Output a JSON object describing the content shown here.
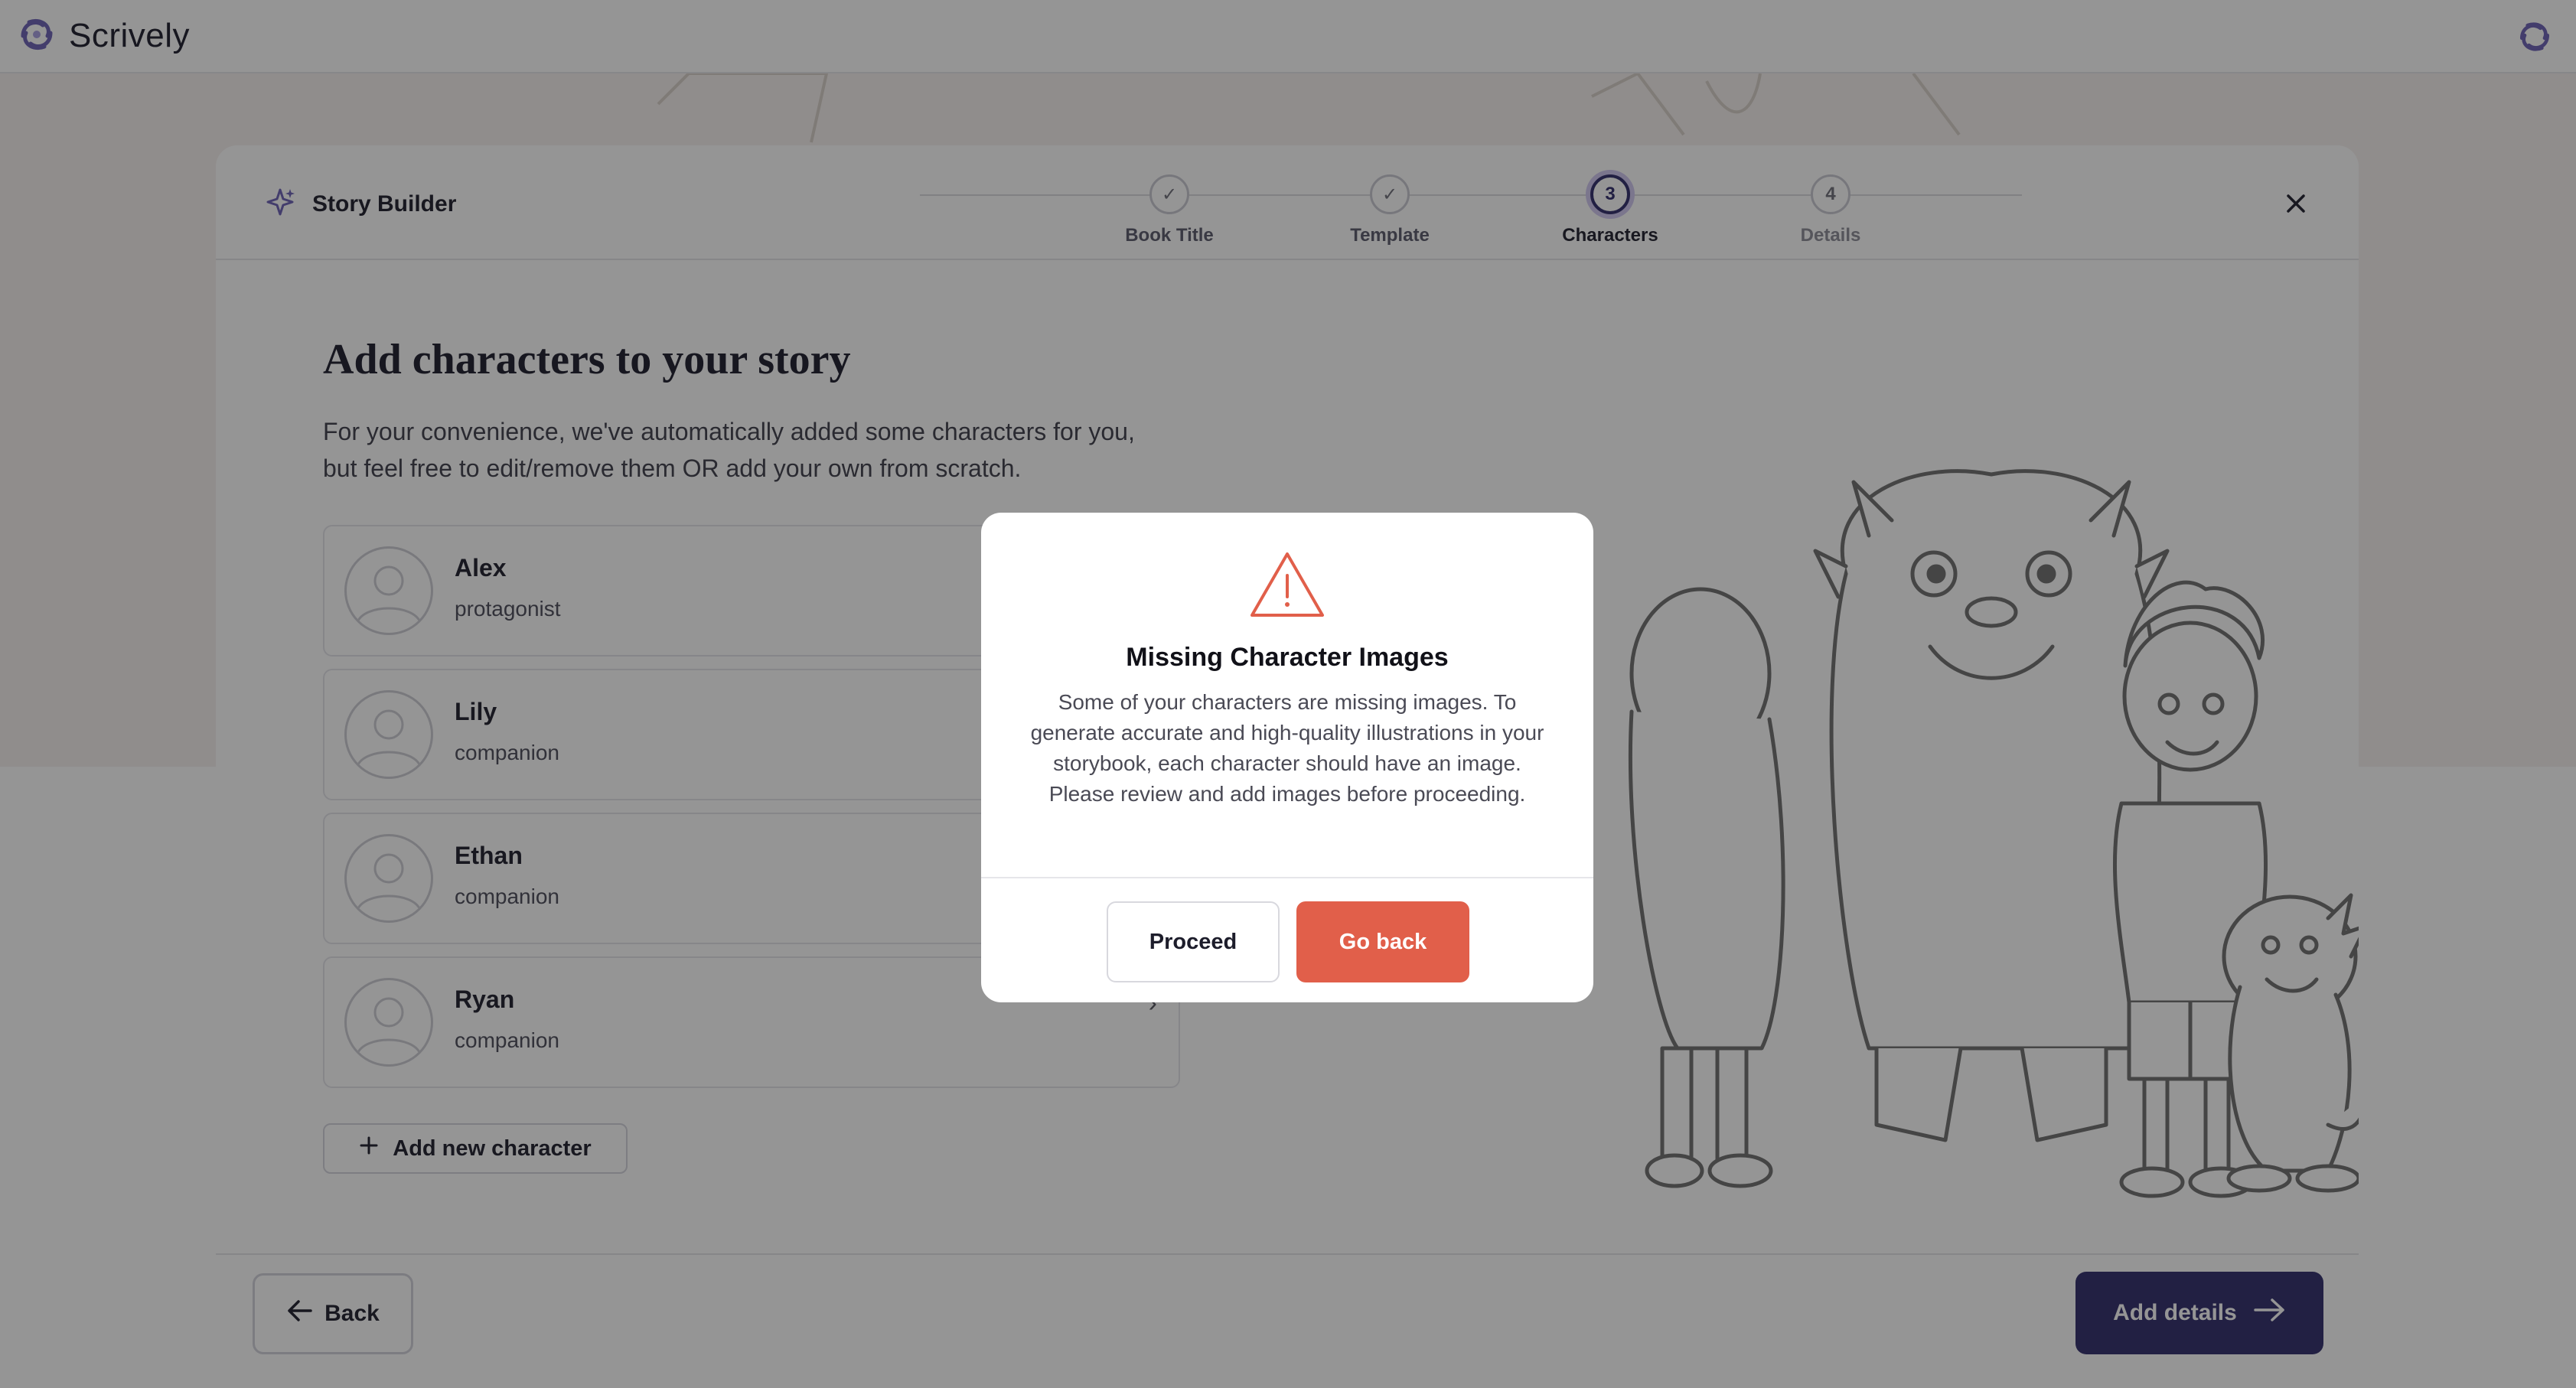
{
  "app": {
    "brand_name": "Scrively",
    "brand_icon": "scrively-logo-icon"
  },
  "builder": {
    "title": "Story Builder",
    "title_icon": "sparkle-icon",
    "close_icon": "close-icon",
    "steps": [
      {
        "label": "Book Title",
        "state": "done",
        "marker": "✓"
      },
      {
        "label": "Template",
        "state": "done",
        "marker": "✓"
      },
      {
        "label": "Characters",
        "state": "current",
        "marker": "3"
      },
      {
        "label": "Details",
        "state": "upcoming",
        "marker": "4"
      }
    ],
    "heading": "Add characters to your story",
    "subtitle": "For your convenience, we've automatically added some characters for you, but feel free to edit/remove them OR add your own from scratch.",
    "characters": [
      {
        "name": "Alex",
        "role": "protagonist"
      },
      {
        "name": "Lily",
        "role": "companion"
      },
      {
        "name": "Ethan",
        "role": "companion"
      },
      {
        "name": "Ryan",
        "role": "companion"
      }
    ],
    "add_character_label": "Add new character",
    "back_label": "Back",
    "next_label": "Add details"
  },
  "alert": {
    "icon": "warning-triangle-icon",
    "title": "Missing Character Images",
    "message": "Some of your characters are missing images. To generate accurate and high-quality illustrations in your storybook, each character should have an image. Please review and add images before proceeding.",
    "proceed_label": "Proceed",
    "go_back_label": "Go back"
  },
  "colors": {
    "primary": "#2f2a6a",
    "danger": "#e15f4a",
    "page_bg": "#f6f1ee",
    "overlay": "rgba(20,20,20,0.45)"
  }
}
